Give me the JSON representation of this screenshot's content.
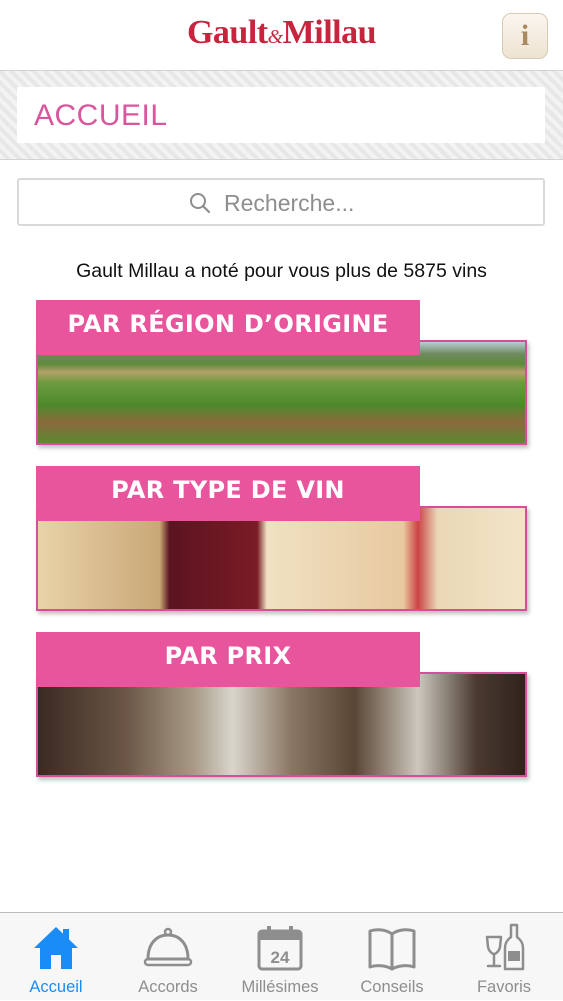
{
  "app": {
    "logo_left": "Gault",
    "logo_amp": "&",
    "logo_right": "Millau",
    "info_label": "i"
  },
  "header": {
    "title": "ACCUEIL"
  },
  "search": {
    "placeholder": "Recherche..."
  },
  "intro": {
    "text": "Gault Millau a noté pour vous plus de 5875 vins"
  },
  "cards": [
    {
      "label": "PAR RÉGION D’ORIGINE",
      "image": "vineyard-photo"
    },
    {
      "label": "PAR TYPE DE VIN",
      "image": "wine-glasses-photo"
    },
    {
      "label": "PAR PRIX",
      "image": "table-glasses-photo"
    }
  ],
  "tabbar": {
    "items": [
      {
        "label": "Accueil",
        "icon": "home-icon",
        "active": true
      },
      {
        "label": "Accords",
        "icon": "cloche-icon",
        "active": false
      },
      {
        "label": "Millésimes",
        "icon": "calendar-icon",
        "calendar_day": "24",
        "active": false
      },
      {
        "label": "Conseils",
        "icon": "book-icon",
        "active": false
      },
      {
        "label": "Favoris",
        "icon": "wine-bottle-glass-icon",
        "active": false
      }
    ]
  },
  "colors": {
    "brand_red": "#c6253d",
    "accent_pink": "#e9559d",
    "header_pink": "#d9559c",
    "tab_active": "#1a8cf5",
    "tab_inactive": "#8e8e8e"
  }
}
